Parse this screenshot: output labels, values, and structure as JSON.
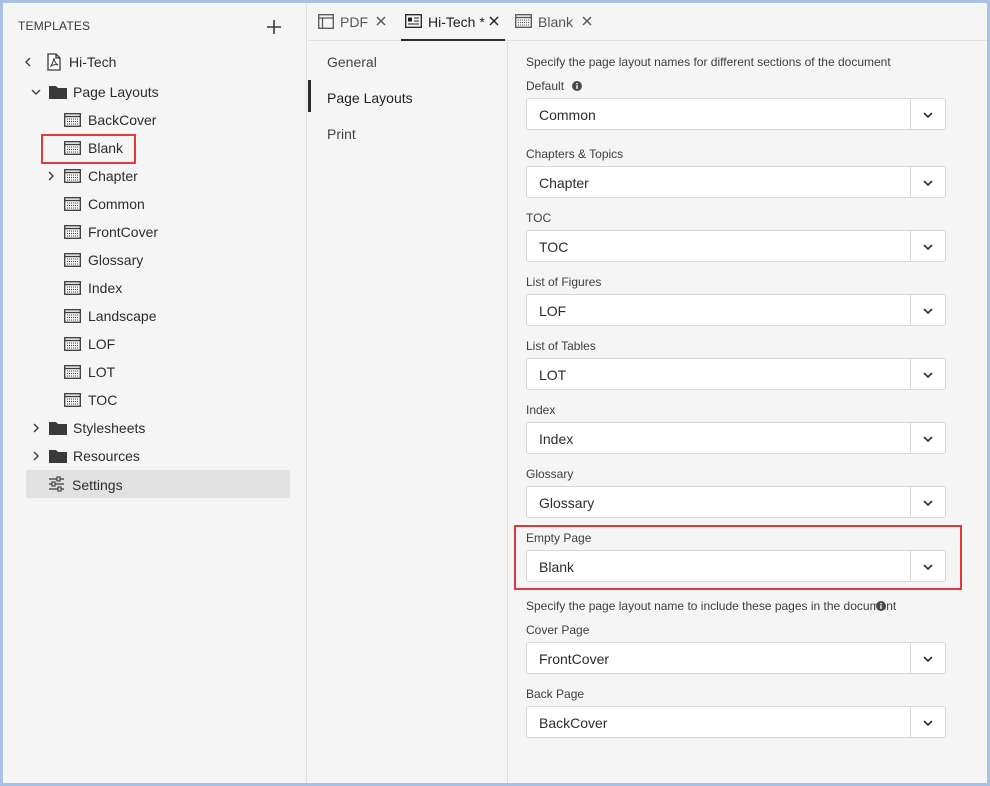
{
  "left_panel": {
    "header": "TEMPLATES",
    "root": "Hi-Tech",
    "page_layouts_folder": "Page Layouts",
    "layouts": [
      "BackCover",
      "Blank",
      "Chapter",
      "Common",
      "FrontCover",
      "Glossary",
      "Index",
      "Landscape",
      "LOF",
      "LOT",
      "TOC"
    ],
    "stylesheets_folder": "Stylesheets",
    "resources_folder": "Resources",
    "settings": "Settings"
  },
  "tabs": [
    {
      "label": "PDF",
      "active": false
    },
    {
      "label": "Hi-Tech *",
      "active": true
    },
    {
      "label": "Blank",
      "active": false
    }
  ],
  "nav": [
    "General",
    "Page Layouts",
    "Print"
  ],
  "form": {
    "intro": "Specify the page layout names for different sections of the document",
    "fields": [
      {
        "label": "Default",
        "value": "Common"
      },
      {
        "label": "Chapters & Topics",
        "value": "Chapter"
      },
      {
        "label": "TOC",
        "value": "TOC"
      },
      {
        "label": "List of Figures",
        "value": "LOF"
      },
      {
        "label": "List of Tables",
        "value": "LOT"
      },
      {
        "label": "Index",
        "value": "Index"
      },
      {
        "label": "Glossary",
        "value": "Glossary"
      },
      {
        "label": "Empty Page",
        "value": "Blank"
      }
    ],
    "intro2": "Specify the page layout name to include these pages in the document",
    "fields2": [
      {
        "label": "Cover Page",
        "value": "FrontCover"
      },
      {
        "label": "Back Page",
        "value": "BackCover"
      }
    ]
  },
  "colors": {
    "highlight": "#e03a3a",
    "accent": "#2c2c2c"
  }
}
